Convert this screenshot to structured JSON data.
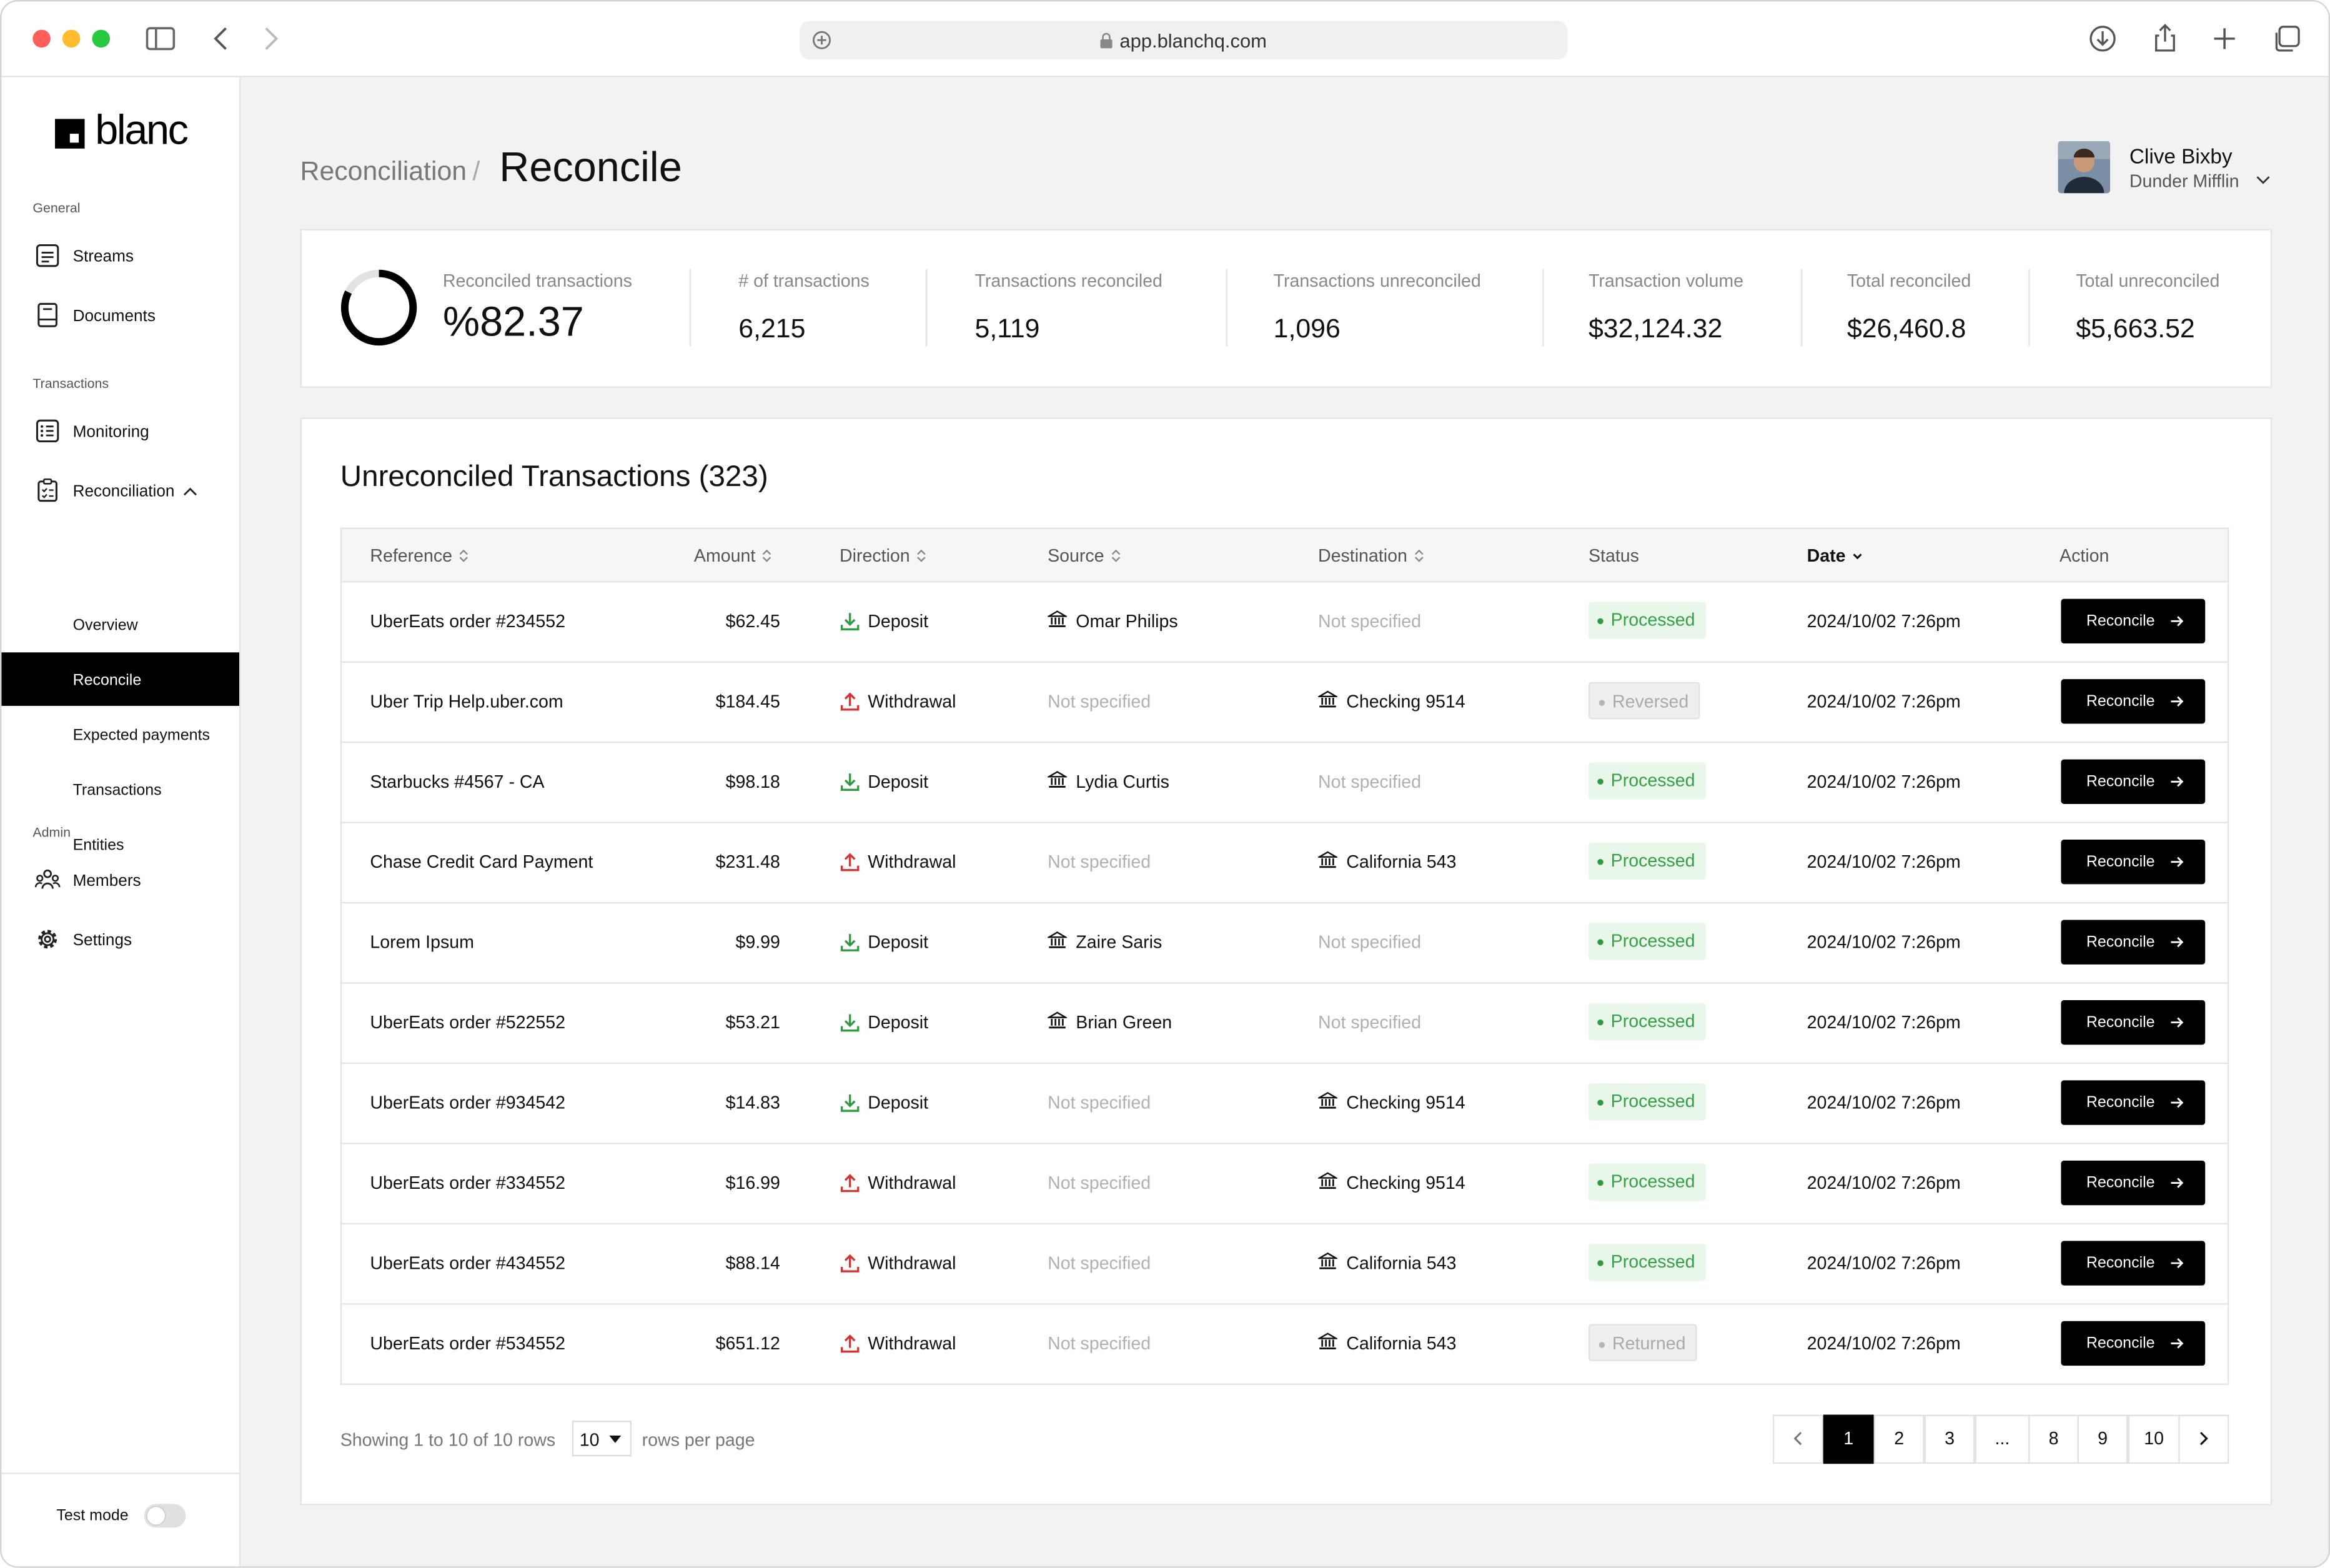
{
  "browser": {
    "url": "app.blanchq.com",
    "colors": {
      "close": "#ff5f57",
      "minimize": "#febc2e",
      "zoom": "#28c840"
    }
  },
  "brand": {
    "name": "blanc"
  },
  "sidebar": {
    "sections": [
      {
        "label": "General",
        "items": [
          {
            "label": "Streams",
            "icon": "streams-icon"
          },
          {
            "label": "Documents",
            "icon": "documents-icon"
          }
        ]
      },
      {
        "label": "Transactions",
        "items": [
          {
            "label": "Monitoring",
            "icon": "monitoring-icon"
          },
          {
            "label": "Reconciliation",
            "icon": "reconciliation-icon",
            "expanded": true,
            "children": [
              {
                "label": "Overview"
              },
              {
                "label": "Reconcile",
                "active": true
              },
              {
                "label": "Expected payments"
              },
              {
                "label": "Transactions"
              },
              {
                "label": "Entities"
              }
            ]
          }
        ]
      },
      {
        "label": "Admin",
        "items": [
          {
            "label": "Members",
            "icon": "members-icon"
          },
          {
            "label": "Settings",
            "icon": "gear-icon"
          }
        ]
      }
    ],
    "test_mode": {
      "label": "Test mode",
      "enabled": false
    }
  },
  "header": {
    "breadcrumb_parent": "Reconciliation",
    "separator": "/",
    "title": "Reconcile"
  },
  "user": {
    "name": "Clive Bixby",
    "org": "Dunder Mifflin"
  },
  "stats": {
    "progress_fraction": 0.8237,
    "reconciled": {
      "label": "Reconciled transactions",
      "value": "%82.37"
    },
    "items": [
      {
        "label": "# of transactions",
        "value": "6,215"
      },
      {
        "label": "Transactions reconciled",
        "value": "5,119"
      },
      {
        "label": "Transactions unreconciled",
        "value": "1,096"
      },
      {
        "label": "Transaction volume",
        "value": "$32,124.32"
      },
      {
        "label": "Total reconciled",
        "value": "$26,460.8"
      },
      {
        "label": "Total unreconciled",
        "value": "$5,663.52"
      }
    ]
  },
  "table": {
    "title": "Unreconciled Transactions (323)",
    "columns": [
      "Reference",
      "Amount",
      "Direction",
      "Source",
      "Destination",
      "Status",
      "Date",
      "Action"
    ],
    "rows": [
      {
        "reference": "UberEats order #234552",
        "amount": "$62.45",
        "direction": "Deposit",
        "source": "Omar Philips",
        "destination": "Not specified",
        "status": "Processed",
        "date": "2024/10/02 7:26pm",
        "action": "Reconcile"
      },
      {
        "reference": "Uber Trip Help.uber.com",
        "amount": "$184.45",
        "direction": "Withdrawal",
        "source": "Not specified",
        "destination": "Checking 9514",
        "status": "Reversed",
        "date": "2024/10/02 7:26pm",
        "action": "Reconcile"
      },
      {
        "reference": "Starbucks #4567 - CA",
        "amount": "$98.18",
        "direction": "Deposit",
        "source": "Lydia Curtis",
        "destination": "Not specified",
        "status": "Processed",
        "date": "2024/10/02 7:26pm",
        "action": "Reconcile"
      },
      {
        "reference": "Chase Credit Card Payment",
        "amount": "$231.48",
        "direction": "Withdrawal",
        "source": "Not specified",
        "destination": "California 543",
        "status": "Processed",
        "date": "2024/10/02 7:26pm",
        "action": "Reconcile"
      },
      {
        "reference": "Lorem Ipsum",
        "amount": "$9.99",
        "direction": "Deposit",
        "source": "Zaire Saris",
        "destination": "Not specified",
        "status": "Processed",
        "date": "2024/10/02 7:26pm",
        "action": "Reconcile"
      },
      {
        "reference": "UberEats order #522552",
        "amount": "$53.21",
        "direction": "Deposit",
        "source": "Brian Green",
        "destination": "Not specified",
        "status": "Processed",
        "date": "2024/10/02 7:26pm",
        "action": "Reconcile"
      },
      {
        "reference": "UberEats order #934542",
        "amount": "$14.83",
        "direction": "Deposit",
        "source": "Not specified",
        "destination": "Checking 9514",
        "status": "Processed",
        "date": "2024/10/02 7:26pm",
        "action": "Reconcile"
      },
      {
        "reference": "UberEats order #334552",
        "amount": "$16.99",
        "direction": "Withdrawal",
        "source": "Not specified",
        "destination": "Checking 9514",
        "status": "Processed",
        "date": "2024/10/02 7:26pm",
        "action": "Reconcile"
      },
      {
        "reference": "UberEats order #434552",
        "amount": "$88.14",
        "direction": "Withdrawal",
        "source": "Not specified",
        "destination": "California 543",
        "status": "Processed",
        "date": "2024/10/02 7:26pm",
        "action": "Reconcile"
      },
      {
        "reference": "UberEats order #534552",
        "amount": "$651.12",
        "direction": "Withdrawal",
        "source": "Not specified",
        "destination": "California 543",
        "status": "Returned",
        "date": "2024/10/02 7:26pm",
        "action": "Reconcile"
      }
    ]
  },
  "pagination": {
    "showing": "Showing 1 to 10 of 10 rows",
    "per_page": "10",
    "per_page_label": "rows per page",
    "pages": [
      "1",
      "2",
      "3",
      "...",
      "8",
      "9",
      "10"
    ],
    "current": "1"
  },
  "colors": {
    "deposit": "#2f9b3f",
    "withdrawal": "#d93030",
    "processed_bg": "#e9f7ea",
    "processed_text": "#36a046"
  }
}
